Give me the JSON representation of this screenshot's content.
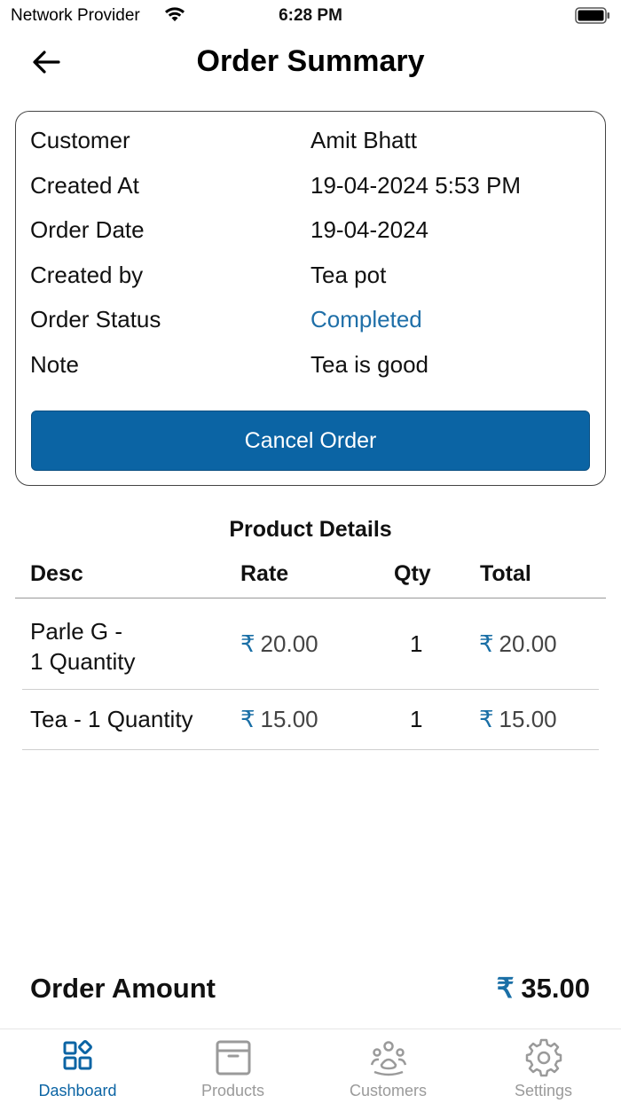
{
  "status_bar": {
    "carrier": "Network Provider",
    "time": "6:28 PM"
  },
  "header": {
    "title": "Order Summary"
  },
  "summary": {
    "rows": [
      {
        "label": "Customer",
        "value": "Amit Bhatt"
      },
      {
        "label": "Created At",
        "value": "19-04-2024 5:53 PM"
      },
      {
        "label": "Order Date",
        "value": "19-04-2024"
      },
      {
        "label": "Created by",
        "value": "Tea pot"
      },
      {
        "label": "Order Status",
        "value": "Completed"
      },
      {
        "label": "Note",
        "value": "Tea is good"
      }
    ],
    "cancel_label": "Cancel Order"
  },
  "products": {
    "title": "Product Details",
    "columns": [
      "Desc",
      "Rate",
      "Qty",
      "Total"
    ],
    "currency_symbol": "₹",
    "items": [
      {
        "desc": "Parle G -\n1 Quantity",
        "rate": "20.00",
        "qty": "1",
        "total": "20.00"
      },
      {
        "desc": "Tea - 1 Quantity",
        "rate": "15.00",
        "qty": "1",
        "total": "15.00"
      }
    ]
  },
  "order_amount": {
    "label": "Order Amount",
    "currency_symbol": "₹",
    "value": "35.00"
  },
  "tabbar": {
    "tabs": [
      {
        "label": "Dashboard",
        "icon": "dashboard-icon",
        "active": true
      },
      {
        "label": "Products",
        "icon": "box-icon",
        "active": false
      },
      {
        "label": "Customers",
        "icon": "customers-icon",
        "active": false
      },
      {
        "label": "Settings",
        "icon": "gear-icon",
        "active": false
      }
    ]
  },
  "colors": {
    "accent": "#0b64a4",
    "status_completed": "#1f6fa8",
    "inactive_tab": "#9a9a9a"
  }
}
